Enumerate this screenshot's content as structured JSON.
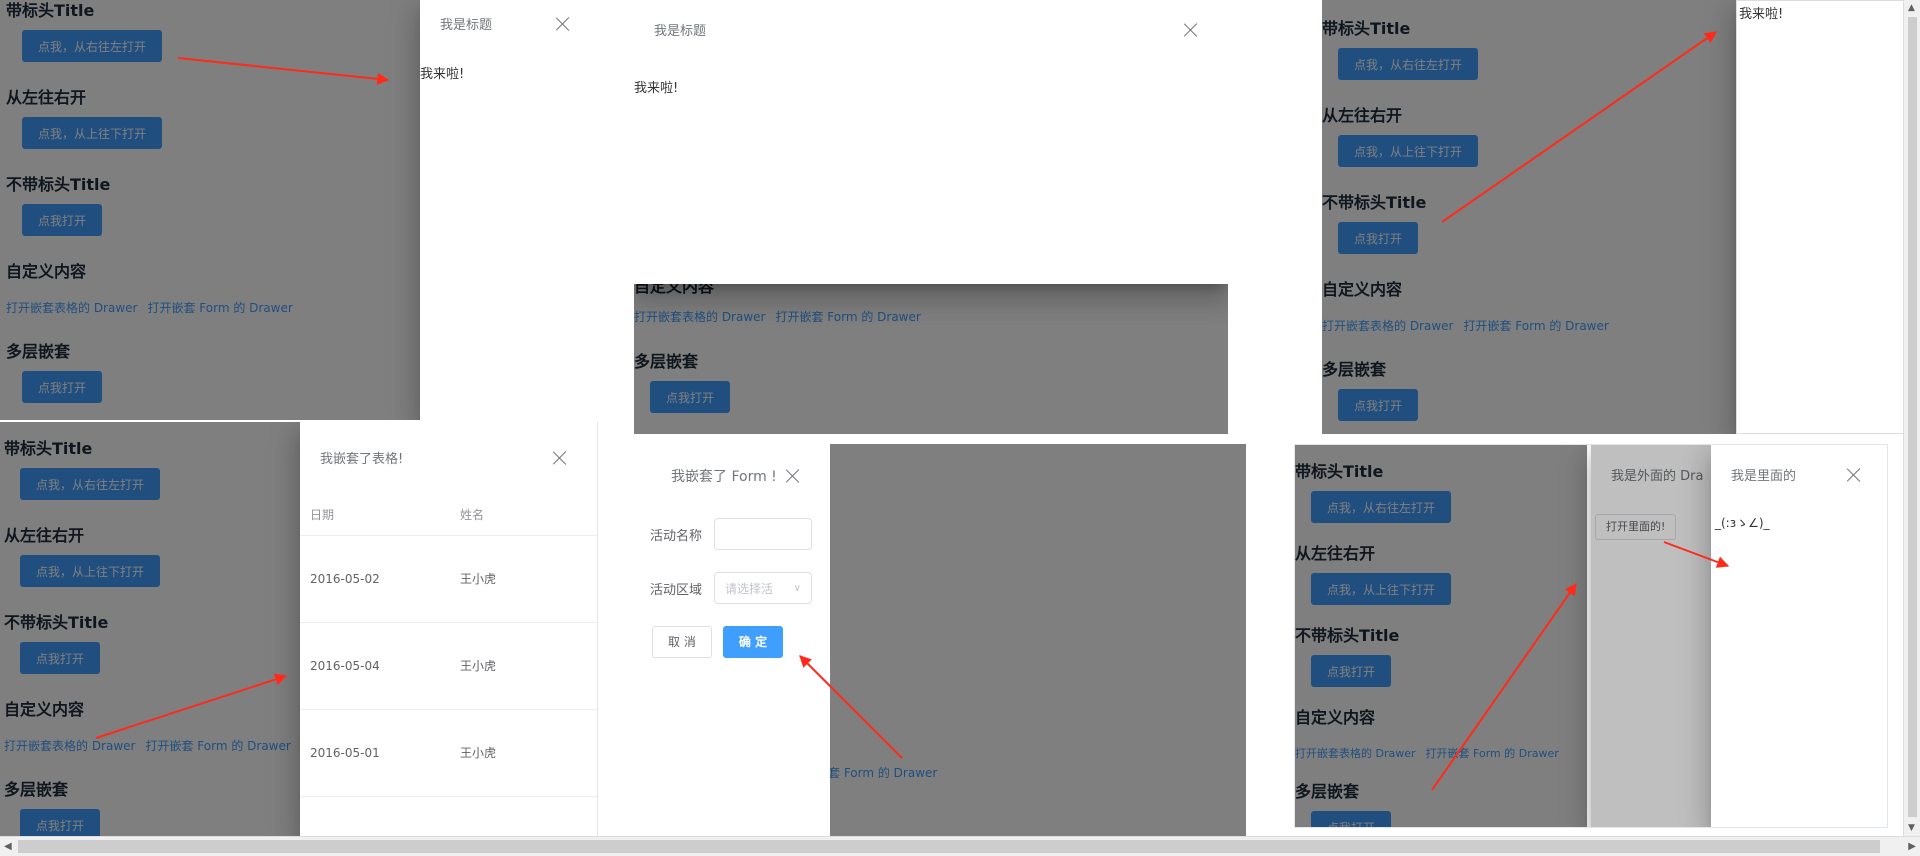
{
  "demo": {
    "sections": [
      {
        "title": "带标头Title",
        "button": "点我，从右往左打开"
      },
      {
        "title": "从左往右开",
        "button": "点我，从上往下打开"
      },
      {
        "title": "不带标头Title",
        "button": "点我打开"
      },
      {
        "title": "自定义内容",
        "links": [
          "打开嵌套表格的 Drawer",
          "打开嵌套 Form 的 Drawer"
        ]
      },
      {
        "title": "多层嵌套",
        "button": "点我打开"
      }
    ]
  },
  "drawer_rtl": {
    "title": "我是标题",
    "body": "我来啦!"
  },
  "drawer_ttb": {
    "title": "我是标题",
    "body": "我来啦!"
  },
  "drawer_notitle": {
    "body": "我来啦!"
  },
  "drawer_table": {
    "title": "我嵌套了表格!",
    "columns": [
      "日期",
      "姓名"
    ],
    "rows": [
      {
        "date": "2016-05-02",
        "name": "王小虎"
      },
      {
        "date": "2016-05-04",
        "name": "王小虎"
      },
      {
        "date": "2016-05-01",
        "name": "王小虎"
      }
    ]
  },
  "drawer_form": {
    "title": "我嵌套了 Form !",
    "fields": [
      {
        "label": "活动名称",
        "value": "",
        "placeholder": ""
      },
      {
        "label": "活动区域",
        "value": "",
        "placeholder": "请选择活"
      }
    ],
    "cancel": "取 消",
    "confirm": "确 定",
    "bg_link_fragment": "套 Form 的 Drawer"
  },
  "drawer_nested": {
    "outer_title": "我是外面的 Dra",
    "outer_button": "打开里面的!",
    "inner_title": "我是里面的",
    "inner_body": "_(:зゝ∠)_"
  },
  "colors": {
    "primary": "#409eff",
    "mask": "rgba(0,0,0,0.5)",
    "arrow": "#ff2a1a"
  }
}
